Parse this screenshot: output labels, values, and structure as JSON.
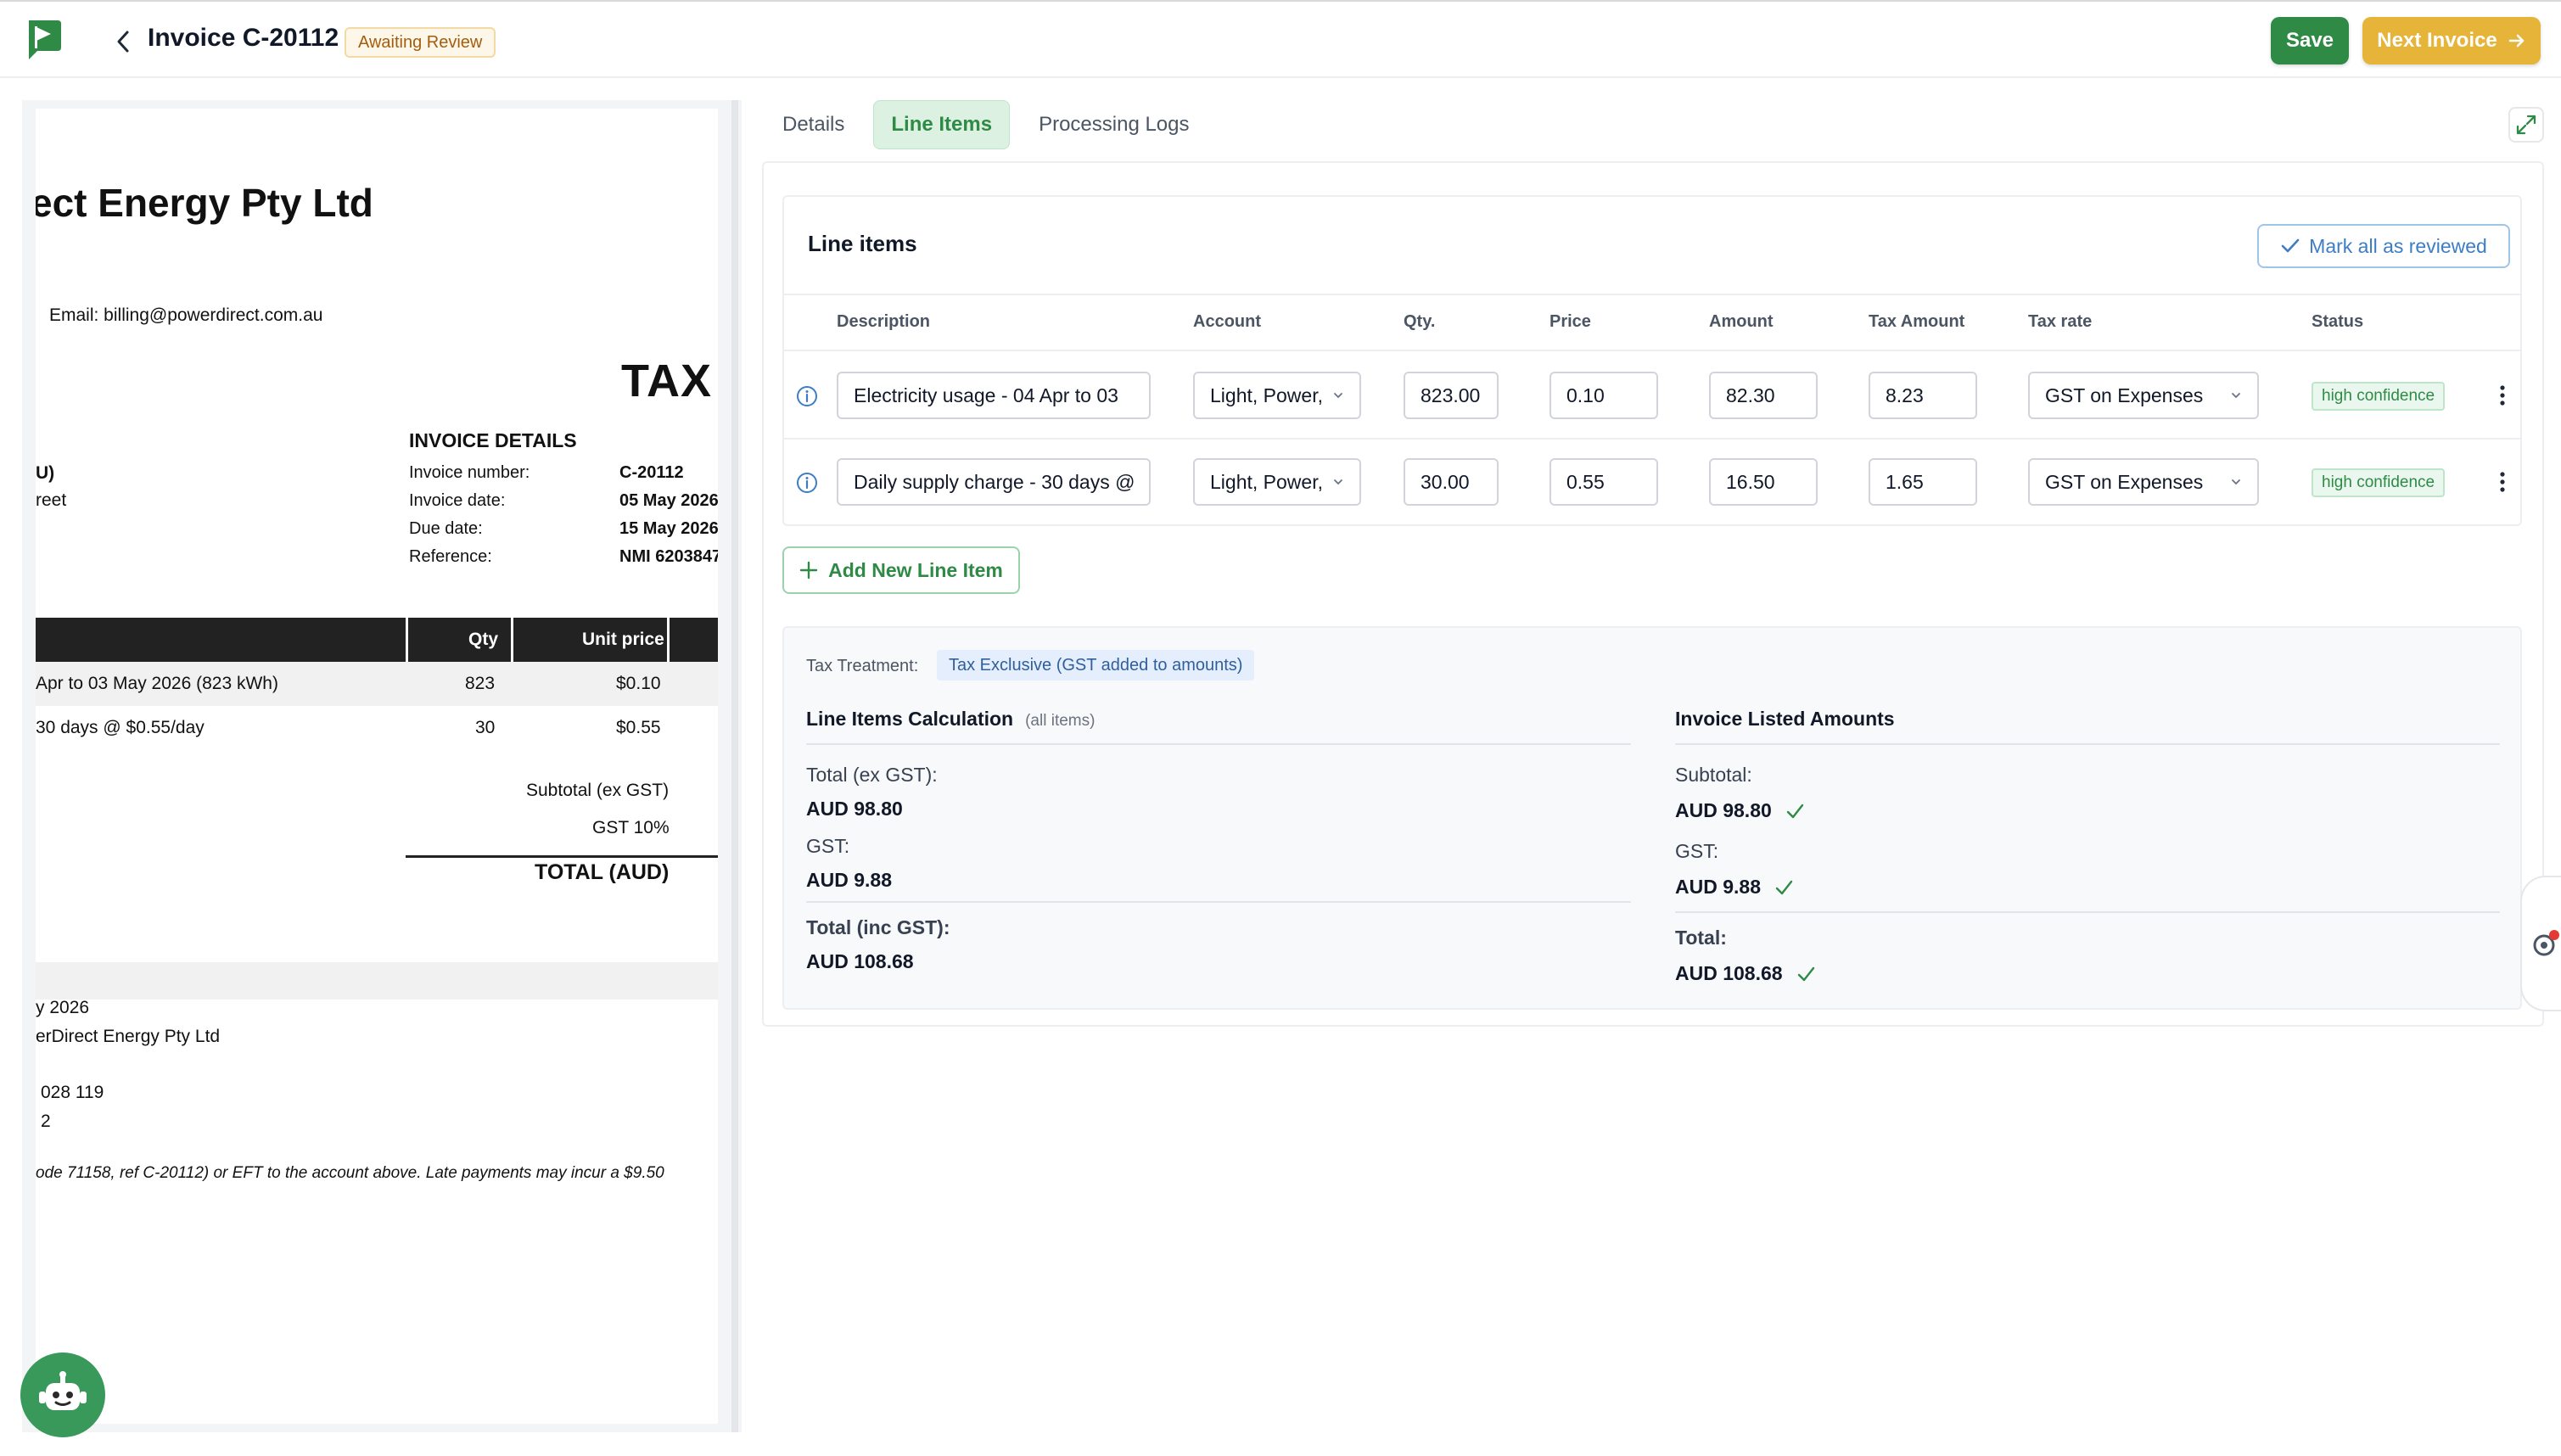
{
  "header": {
    "title": "Invoice C-20112",
    "status_badge": "Awaiting Review",
    "save_label": "Save",
    "next_label": "Next Invoice"
  },
  "preview": {
    "company": "ect Energy Pty Ltd",
    "email": "Email: billing@powerdirect.com.au",
    "tax_heading": "TAX",
    "bill_to_1": "U)",
    "bill_to_2": "reet",
    "invoice_details_heading": "INVOICE DETAILS",
    "details": [
      {
        "label": "Invoice number:",
        "value": "C-20112"
      },
      {
        "label": "Invoice date:",
        "value": "05 May 2026"
      },
      {
        "label": "Due date:",
        "value": "15 May 2026"
      },
      {
        "label": "Reference:",
        "value": "NMI 6203847"
      }
    ],
    "table_headers": {
      "qty": "Qty",
      "unit_price": "Unit price"
    },
    "rows": [
      {
        "desc": "Apr to 03 May 2026 (823 kWh)",
        "qty": "823",
        "price": "$0.10"
      },
      {
        "desc": "30 days @ $0.55/day",
        "qty": "30",
        "price": "$0.55"
      }
    ],
    "subtotal_label": "Subtotal (ex GST)",
    "gst_label": "GST 10%",
    "total_label": "TOTAL (AUD)",
    "footer_1": "y 2026",
    "footer_2": "erDirect Energy Pty Ltd",
    "footer_3": "028 119",
    "footer_4": "2",
    "footer_note": "ode 71158, ref C-20112) or EFT to the account above. Late payments may incur a $9.50"
  },
  "tabs": [
    "Details",
    "Line Items",
    "Processing Logs"
  ],
  "line_items": {
    "title": "Line items",
    "mark_all_label": "Mark all as reviewed",
    "columns": [
      "Description",
      "Account",
      "Qty.",
      "Price",
      "Amount",
      "Tax Amount",
      "Tax rate",
      "Status"
    ],
    "rows": [
      {
        "description": "Electricity usage - 04 Apr to 03",
        "account": "Light, Power,",
        "qty": "823.00",
        "price": "0.10",
        "amount": "82.30",
        "tax_amount": "8.23",
        "tax_rate": "GST on Expenses",
        "status": "high confidence"
      },
      {
        "description": "Daily supply charge - 30 days @",
        "account": "Light, Power,",
        "qty": "30.00",
        "price": "0.55",
        "amount": "16.50",
        "tax_amount": "1.65",
        "tax_rate": "GST on Expenses",
        "status": "high confidence"
      }
    ],
    "add_label": "Add New Line Item"
  },
  "calc": {
    "tax_treatment_label": "Tax Treatment:",
    "tax_treatment_value": "Tax Exclusive (GST added to amounts)",
    "left_title": "Line Items Calculation",
    "left_sub": "(all items)",
    "right_title": "Invoice Listed Amounts",
    "left": [
      {
        "label": "Total (ex GST):",
        "value": "AUD 98.80"
      },
      {
        "label": "GST:",
        "value": "AUD 9.88"
      },
      {
        "label": "Total (inc GST):",
        "value": "AUD 108.68"
      }
    ],
    "right": [
      {
        "label": "Subtotal:",
        "value": "AUD 98.80"
      },
      {
        "label": "GST:",
        "value": "AUD 9.88"
      },
      {
        "label": "Total:",
        "value": "AUD 108.68"
      }
    ]
  },
  "colors": {
    "primary_green": "#2f8a46",
    "accent_gold": "#e7b43a",
    "link_blue": "#3d7dc4"
  }
}
